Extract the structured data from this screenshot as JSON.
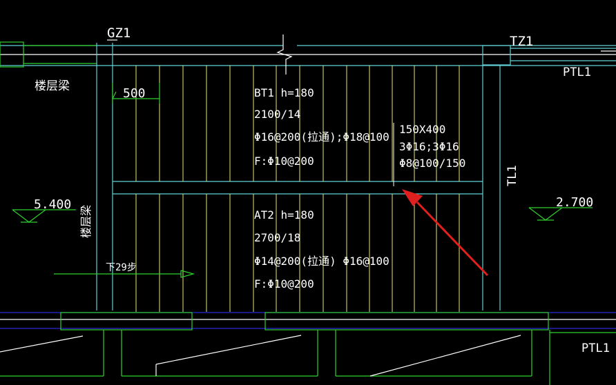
{
  "labels": {
    "gz1": "GZ1",
    "tz1": "TZ1",
    "ptl1_top": "PTL1",
    "ptl1_bottom": "PTL1",
    "floor_beam_h": "楼层梁",
    "floor_beam_v": "楼层梁",
    "dim_500": "500",
    "tl1": "TL1",
    "elev_left": "5.400",
    "elev_right": "2.700",
    "down_steps": "下29步"
  },
  "bt1": {
    "line1": "BT1  h=180",
    "line2": "2100/14",
    "line3": "Φ16@200(拉通);Φ18@100",
    "line4": "F:Φ10@200"
  },
  "beam": {
    "line1": "150X400",
    "line2": "3Φ16;3Φ16",
    "line3": "Φ8@100/150"
  },
  "at2": {
    "line1": "AT2  h=180",
    "line2": "2700/18",
    "line3": "Φ14@200(拉通) Φ16@100",
    "line4": "F:Φ10@200"
  },
  "colors": {
    "background": "#000000",
    "cyan": "#5fd3d8",
    "yellow": "#e6e67a",
    "green": "#2fd12f",
    "white": "#ffffff",
    "blue": "#2b2bd6",
    "arrow_red": "#e0201e"
  }
}
